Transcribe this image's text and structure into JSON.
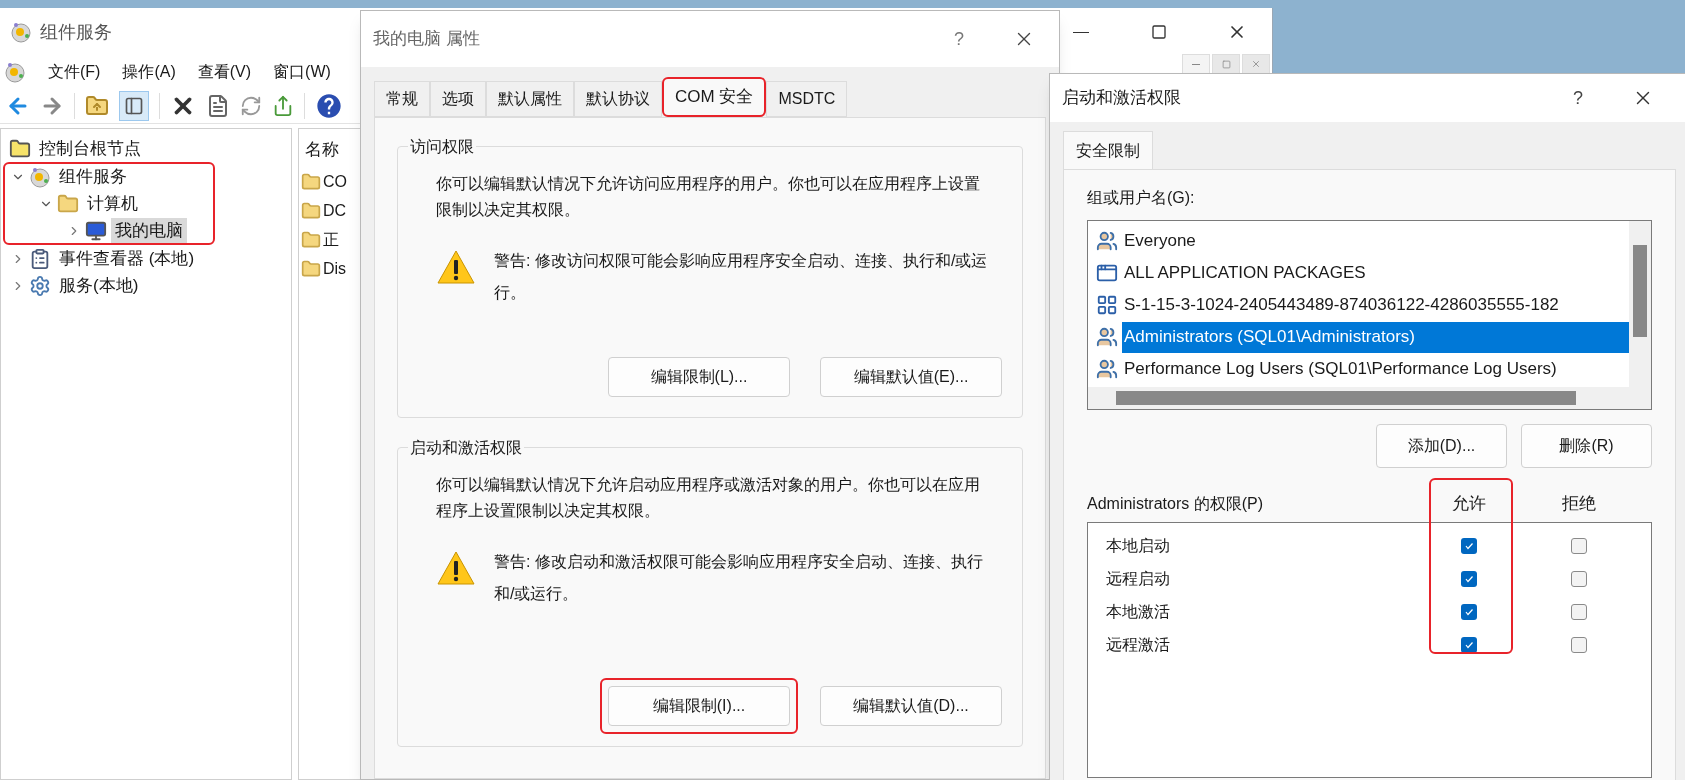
{
  "main_window": {
    "title": "组件服务",
    "menu": [
      "文件(F)",
      "操作(A)",
      "查看(V)",
      "窗口(W)"
    ],
    "tree": [
      {
        "label": "控制台根节点",
        "kind": "root",
        "children": [
          {
            "label": "组件服务",
            "kind": "component-services",
            "expanded": true,
            "highlighted": true,
            "children": [
              {
                "label": "计算机",
                "kind": "folder",
                "expanded": true,
                "children": [
                  {
                    "label": "我的电脑",
                    "kind": "computer",
                    "expanded": false,
                    "selected": true
                  }
                ]
              }
            ]
          },
          {
            "label": "事件查看器 (本地)",
            "kind": "event-viewer",
            "expanded": false,
            "highlighted": false
          },
          {
            "label": "服务(本地)",
            "kind": "services",
            "expanded": false,
            "highlighted": false
          }
        ]
      }
    ],
    "list": {
      "column": "名称",
      "items": [
        "CO",
        "DC",
        "正",
        "Dis"
      ]
    }
  },
  "properties_dialog": {
    "title": "我的电脑 属性",
    "help": "?",
    "tabs": [
      {
        "label": "常规",
        "selected": false,
        "highlighted": false
      },
      {
        "label": "选项",
        "selected": false,
        "highlighted": false
      },
      {
        "label": "默认属性",
        "selected": false,
        "highlighted": false
      },
      {
        "label": "默认协议",
        "selected": false,
        "highlighted": false
      },
      {
        "label": "COM 安全",
        "selected": true,
        "highlighted": true
      },
      {
        "label": "MSDTC",
        "selected": false,
        "highlighted": false
      }
    ],
    "groups": [
      {
        "title": "访问权限",
        "description": "你可以编辑默认情况下允许访问应用程序的用户。你也可以在应用程序上设置限制以决定其权限。",
        "warning": "警告: 修改访问权限可能会影响应用程序安全启动、连接、执行和/或运行。",
        "buttons": [
          {
            "label": "编辑限制(L)...",
            "highlighted": false
          },
          {
            "label": "编辑默认值(E)...",
            "highlighted": false
          }
        ]
      },
      {
        "title": "启动和激活权限",
        "description": "你可以编辑默认情况下允许启动应用程序或激活对象的用户。你也可以在应用程序上设置限制以决定其权限。",
        "warning": "警告: 修改启动和激活权限可能会影响应用程序安全启动、连接、执行和/或运行。",
        "buttons": [
          {
            "label": "编辑限制(I)...",
            "highlighted": true
          },
          {
            "label": "编辑默认值(D)...",
            "highlighted": false
          }
        ]
      }
    ]
  },
  "launch_dialog": {
    "title": "启动和激活权限",
    "help": "?",
    "tabs": [
      {
        "label": "安全限制",
        "selected": true
      }
    ],
    "users_label": "组或用户名(G):",
    "users": [
      {
        "name": "Everyone",
        "kind": "group",
        "selected": false
      },
      {
        "name": "ALL APPLICATION PACKAGES",
        "kind": "package",
        "selected": false
      },
      {
        "name": "S-1-15-3-1024-2405443489-874036122-4286035555-182",
        "kind": "sid",
        "selected": false
      },
      {
        "name": "Administrators (SQL01\\Administrators)",
        "kind": "group",
        "selected": true
      },
      {
        "name": "Performance Log Users (SQL01\\Performance Log Users)",
        "kind": "group",
        "selected": false
      }
    ],
    "buttons": [
      "添加(D)...",
      "删除(R)"
    ],
    "permissions_label": "Administrators 的权限(P)",
    "columns": [
      {
        "label": "允许",
        "highlighted": true
      },
      {
        "label": "拒绝",
        "highlighted": false
      }
    ],
    "permissions": [
      {
        "name": "本地启动",
        "allow": true,
        "deny": false
      },
      {
        "name": "远程启动",
        "allow": true,
        "deny": false
      },
      {
        "name": "本地激活",
        "allow": true,
        "deny": false
      },
      {
        "name": "远程激活",
        "allow": true,
        "deny": false
      }
    ]
  }
}
